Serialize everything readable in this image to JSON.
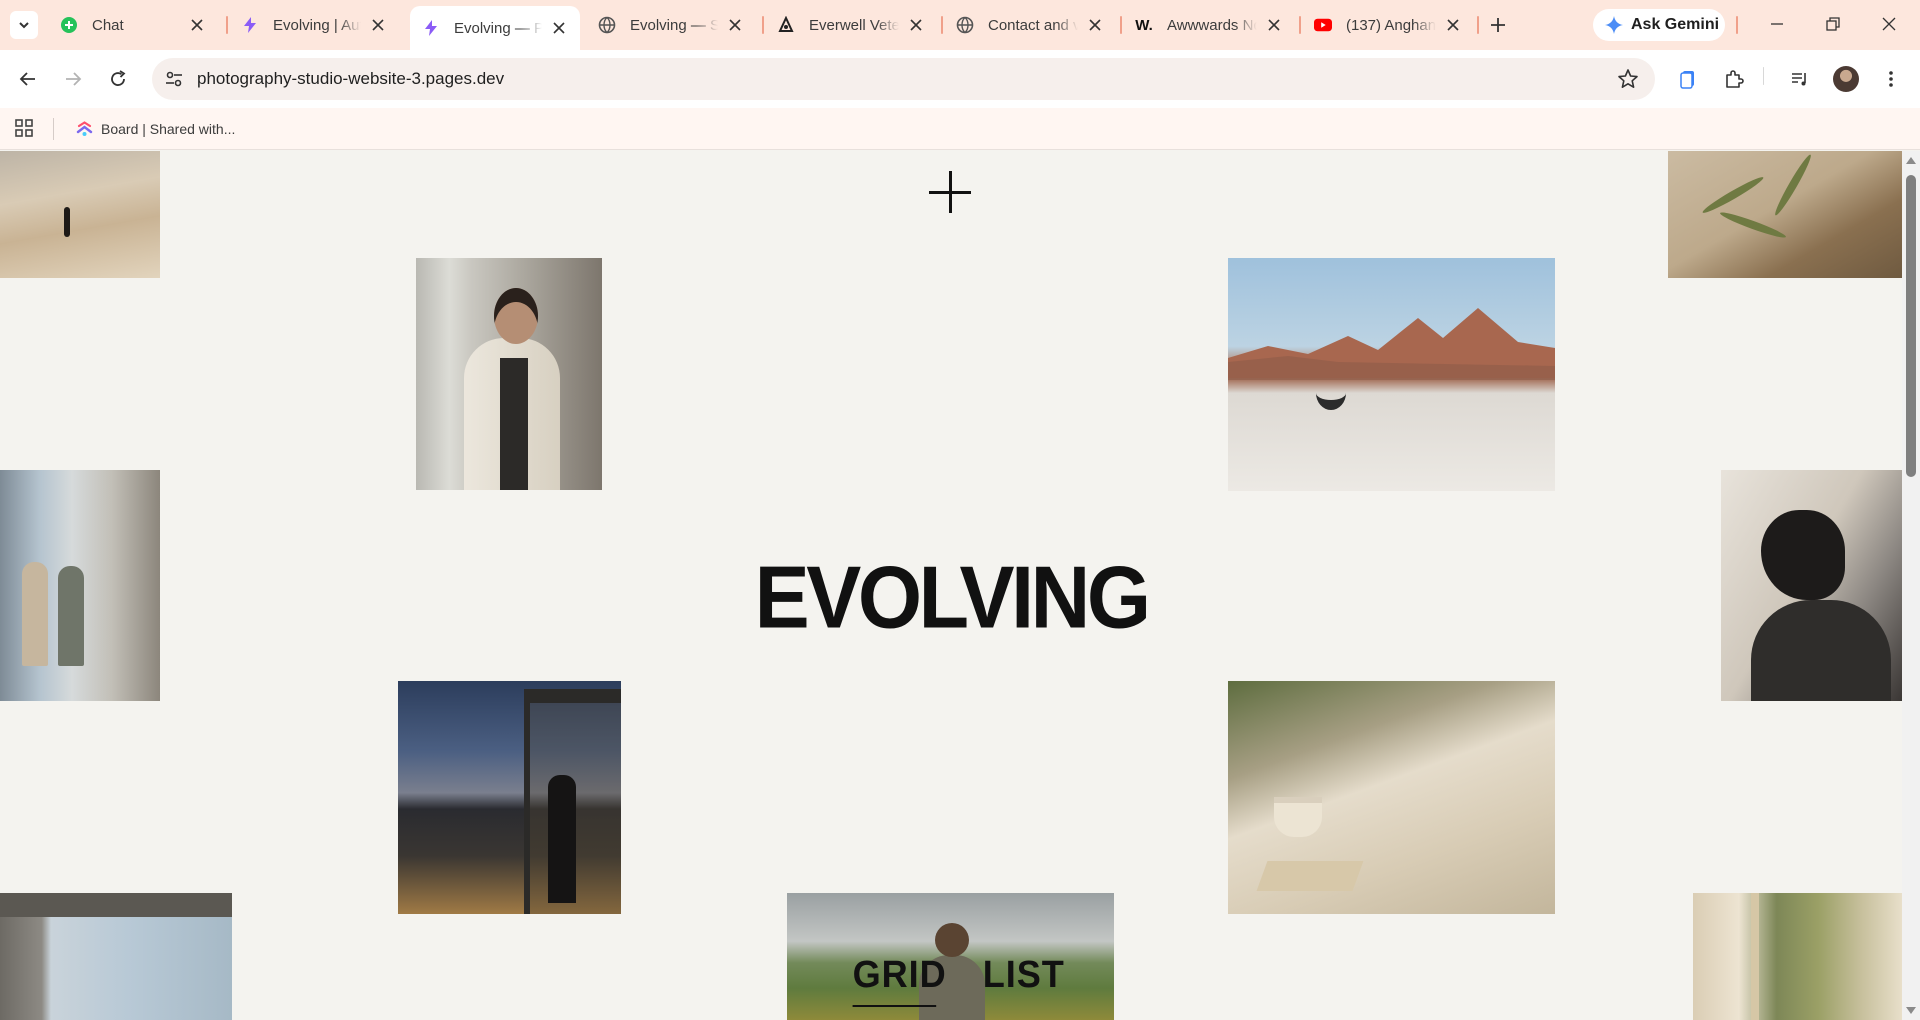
{
  "browser": {
    "tabs": [
      {
        "title": "Chat",
        "favicon": "chat-icon",
        "active": false
      },
      {
        "title": "Evolving | Aut",
        "favicon": "framer-bolt-icon",
        "active": false
      },
      {
        "title": "Evolving — Pl",
        "favicon": "framer-bolt-icon",
        "active": true
      },
      {
        "title": "Evolving — St",
        "favicon": "globe-icon",
        "active": false
      },
      {
        "title": "Everwell Vete",
        "favicon": "everwell-icon",
        "active": false
      },
      {
        "title": "Contact and v",
        "favicon": "globe-icon",
        "active": false
      },
      {
        "title": "Awwwards Nc",
        "favicon": "awwwards-icon",
        "active": false
      },
      {
        "title": "(137) Anghan",
        "favicon": "youtube-icon",
        "active": false
      }
    ],
    "gemini_label": "Ask Gemini",
    "url": "photography-studio-website-3.pages.dev",
    "bookmark": "Board | Shared with...",
    "colors": {
      "tab_strip": "#fde7dd",
      "accent": "#e46d4e"
    }
  },
  "page": {
    "title": "EVOLVING",
    "toggle": {
      "grid": "GRID",
      "list": "LIST",
      "active": "grid"
    },
    "photos": [
      {
        "name": "dune-walker-photo"
      },
      {
        "name": "plant-on-linen-photo"
      },
      {
        "name": "portrait-by-window-photo"
      },
      {
        "name": "desert-cyclist-photo"
      },
      {
        "name": "glass-hallway-photo"
      },
      {
        "name": "veiled-woman-photo"
      },
      {
        "name": "night-window-photo"
      },
      {
        "name": "table-still-life-photo"
      },
      {
        "name": "sea-window-photo"
      },
      {
        "name": "field-woman-photo"
      },
      {
        "name": "garden-window-photo"
      }
    ]
  }
}
